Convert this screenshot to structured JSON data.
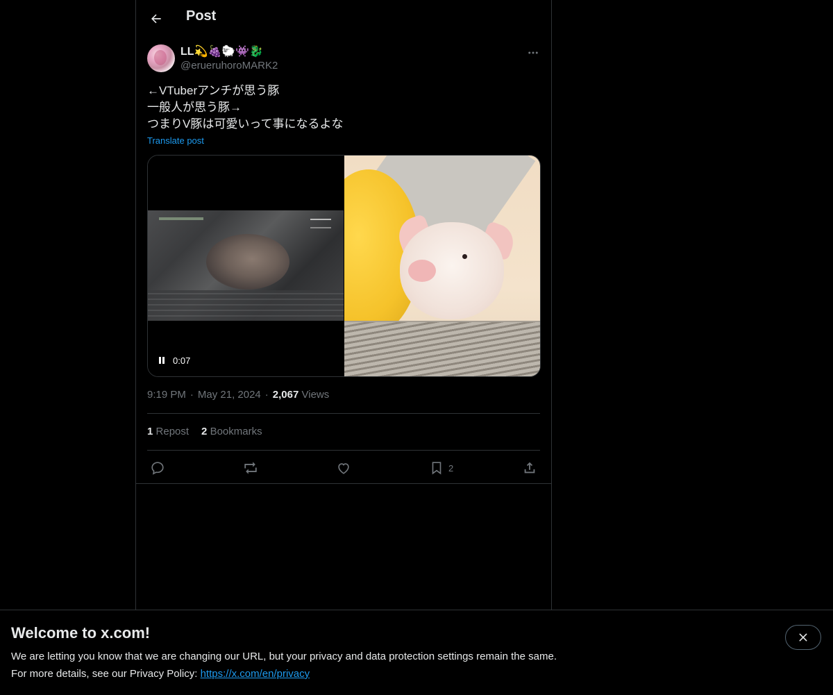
{
  "header": {
    "title": "Post",
    "back_icon": "arrow-left-icon"
  },
  "author": {
    "display_name": "LL💫🍇🐑👾🐉",
    "username": "@erueruhoroMARK2"
  },
  "post": {
    "lines": [
      "←VTuberアンチが思う豚",
      "一般人が思う豚→",
      "つまりV豚は可愛いって事になるよな"
    ],
    "translate_label": "Translate post"
  },
  "media": {
    "video_time": "0:07",
    "video_state": "playing",
    "image_subject": "piglet-in-basket"
  },
  "meta": {
    "time": "9:19 PM",
    "separator": "·",
    "date": "May 21, 2024",
    "views_count": "2,067",
    "views_label": "Views"
  },
  "stats": {
    "reposts_count": "1",
    "reposts_label": "Repost",
    "bookmarks_count": "2",
    "bookmarks_label": "Bookmarks"
  },
  "actions": {
    "reply_icon": "reply-icon",
    "repost_icon": "repost-icon",
    "like_icon": "like-icon",
    "bookmark_icon": "bookmark-icon",
    "bookmark_count": "2",
    "share_icon": "share-icon"
  },
  "banner": {
    "title": "Welcome to x.com!",
    "line1": "We are letting you know that we are changing our URL, but your privacy and data protection settings remain the same.",
    "line2_prefix": "For more details, see our Privacy Policy: ",
    "link_text": "https://x.com/en/privacy"
  },
  "colors": {
    "background": "#000000",
    "text": "#e7e9ea",
    "muted": "#71767b",
    "accent": "#1d9bf0",
    "border": "#2f3336"
  }
}
